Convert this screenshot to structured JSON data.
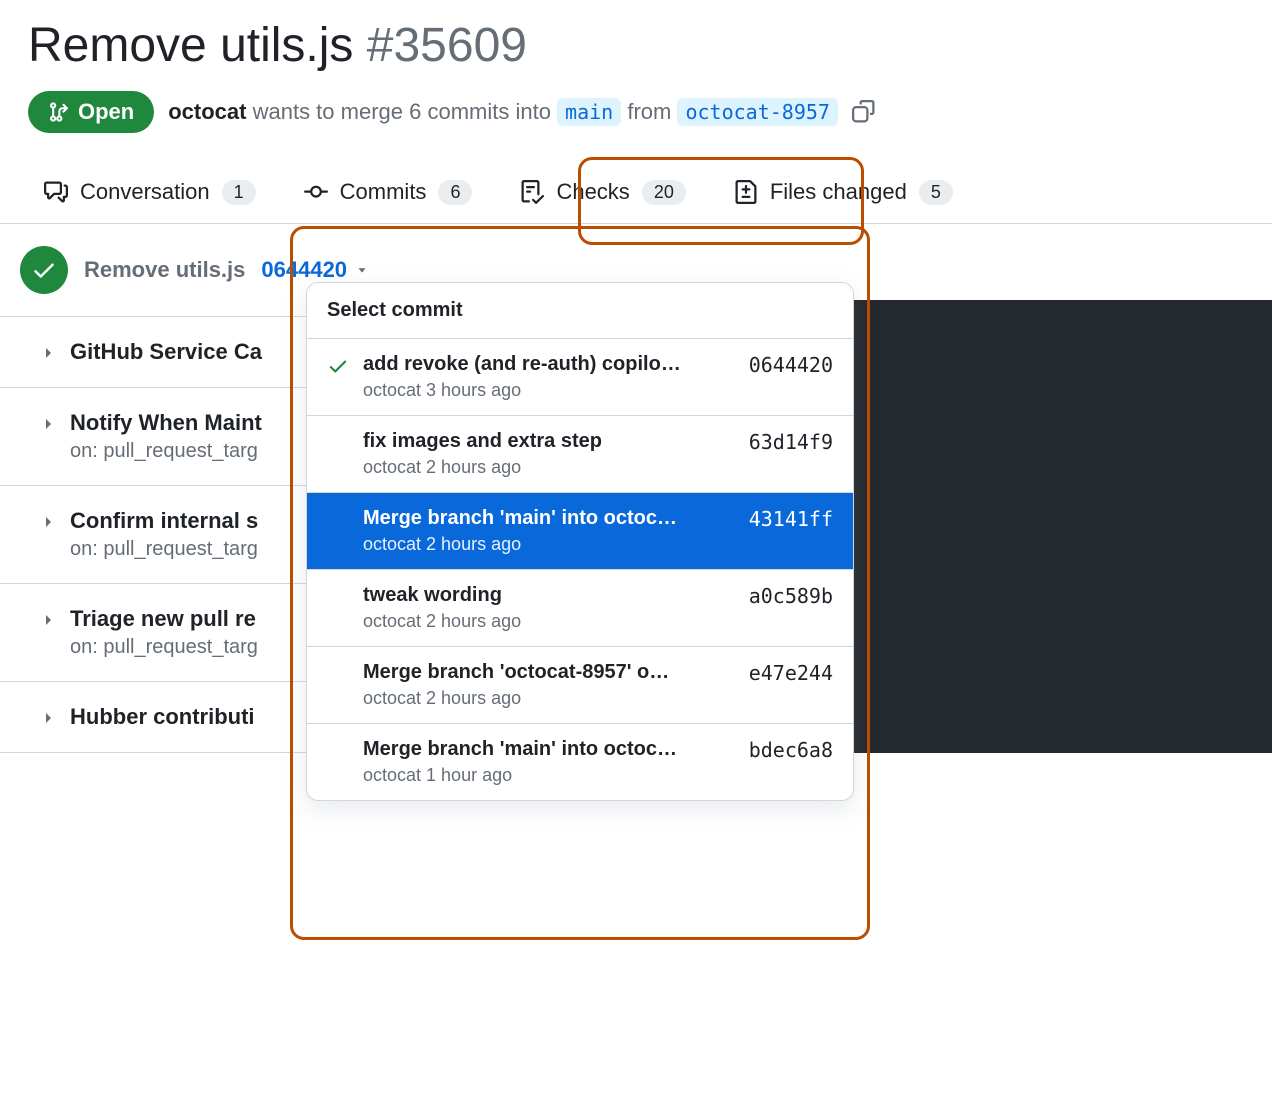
{
  "header": {
    "title": "Remove utils.js",
    "issue_number": "#35609"
  },
  "status": {
    "state_label": "Open",
    "author": "octocat",
    "merge_text_1": " wants to merge 6 commits into ",
    "base_branch": "main",
    "merge_text_2": " from ",
    "head_branch": "octocat-8957"
  },
  "tabs": {
    "conversation": {
      "label": "Conversation",
      "count": "1"
    },
    "commits": {
      "label": "Commits",
      "count": "6"
    },
    "checks": {
      "label": "Checks",
      "count": "20"
    },
    "files": {
      "label": "Files changed",
      "count": "5"
    }
  },
  "checks_header": {
    "title": "Remove utils.js",
    "sha": "0644420"
  },
  "check_items": [
    {
      "title": "GitHub Service Ca",
      "sub": ""
    },
    {
      "title": "Notify When Maint",
      "sub": "on: pull_request_targ"
    },
    {
      "title": "Confirm internal s",
      "sub": "on: pull_request_targ"
    },
    {
      "title": "Triage new pull re",
      "sub": "on: pull_request_targ"
    },
    {
      "title": "Hubber contributi",
      "sub": ""
    }
  ],
  "dropdown": {
    "header": "Select commit",
    "items": [
      {
        "title": "add revoke (and re-auth) copilo…",
        "sub": "octocat 3 hours ago",
        "sha": "0644420",
        "check": true,
        "selected": false
      },
      {
        "title": "fix images and extra step",
        "sub": "octocat 2 hours ago",
        "sha": "63d14f9",
        "check": false,
        "selected": false
      },
      {
        "title": "Merge branch 'main' into octoc…",
        "sub": "octocat 2 hours ago",
        "sha": "43141ff",
        "check": false,
        "selected": true
      },
      {
        "title": "tweak wording",
        "sub": "octocat 2 hours ago",
        "sha": "a0c589b",
        "check": false,
        "selected": false
      },
      {
        "title": "Merge branch 'octocat-8957' o…",
        "sub": "octocat 2 hours ago",
        "sha": "e47e244",
        "check": false,
        "selected": false
      },
      {
        "title": "Merge branch 'main' into octoc…",
        "sub": "octocat 1 hour ago",
        "sha": "bdec6a8",
        "check": false,
        "selected": false
      }
    ]
  }
}
